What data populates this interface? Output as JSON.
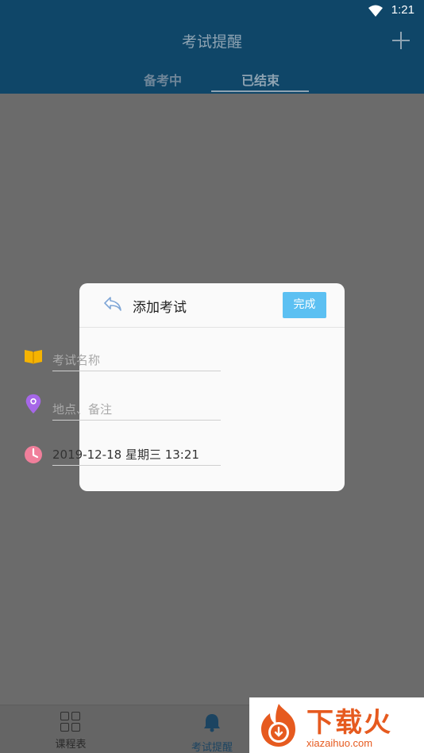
{
  "status_bar": {
    "time": "1:21"
  },
  "header": {
    "title": "考试提醒",
    "add_icon": "plus-icon"
  },
  "tabs": [
    {
      "label": "备考中",
      "active": false
    },
    {
      "label": "已结束",
      "active": true
    }
  ],
  "dialog": {
    "title": "添加考试",
    "done_label": "完成",
    "back_icon": "back-arrow-icon",
    "fields": {
      "exam_name": {
        "placeholder": "考试名称",
        "value": "",
        "icon": "book-icon",
        "icon_color": "#f5b301"
      },
      "location": {
        "placeholder": "地点、备注",
        "value": "",
        "icon": "location-pin-icon",
        "icon_color": "#a667e8"
      },
      "datetime": {
        "value": "2019-12-18  星期三  13:21",
        "icon": "clock-icon",
        "icon_color": "#f07f9b"
      }
    },
    "accent_color": "#5cc0f2"
  },
  "bottom_nav": [
    {
      "label": "课程表",
      "icon": "grid-icon"
    },
    {
      "label": "考试提醒",
      "icon": "bell-icon",
      "active": true
    }
  ],
  "watermark": {
    "brand": "下载火",
    "url": "xiazaihuo.com"
  },
  "colors": {
    "header_bg": "#0f4668",
    "overlay": "#6b6b6b"
  }
}
